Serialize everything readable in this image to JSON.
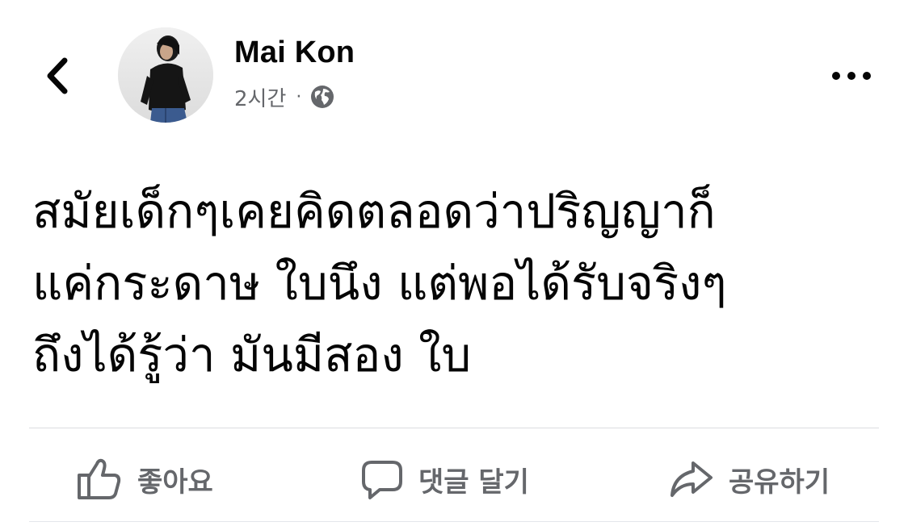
{
  "post": {
    "author": "Mai Kon",
    "time": "2시간",
    "separator": "·",
    "privacy_icon": "globe-icon",
    "text_lines": [
      "สมัยเด็กๆเคยคิดตลอดว่าปริญญาก็",
      "แค่กระดาษ ใบนึง แต่พอได้รับจริงๆ",
      "ถึงได้รู้ว่า มันมีสอง ใบ"
    ]
  },
  "header": {
    "back_icon": "chevron-left-icon",
    "more_icon": "more-horizontal-icon"
  },
  "actions": {
    "like_label": "좋아요",
    "comment_label": "댓글 달기",
    "share_label": "공유하기"
  },
  "colors": {
    "text_primary": "#050505",
    "text_secondary": "#65676b",
    "divider": "#dcdde0",
    "background": "#ffffff"
  }
}
